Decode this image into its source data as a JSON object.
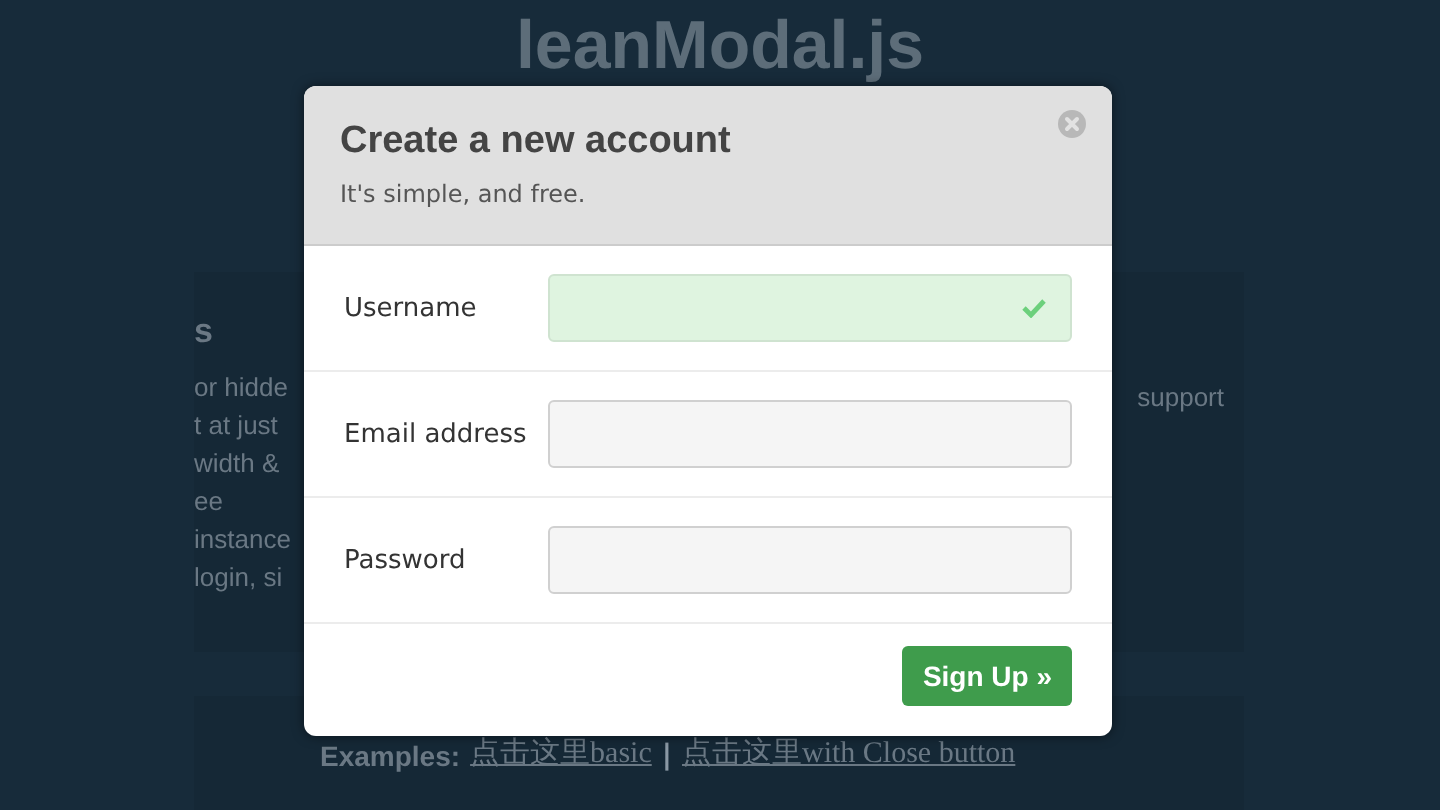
{
  "page": {
    "title": "leanModal.js",
    "panel": {
      "heading": "s",
      "left_lines": [
        "or hidde",
        "t at just",
        "width &",
        "ee",
        "instance",
        "login, si"
      ],
      "right_lines": [
        "support"
      ]
    },
    "examples": {
      "label": "Examples:",
      "separator": "|",
      "links": [
        "点击这里basic",
        "点击这里with Close button"
      ]
    }
  },
  "modal": {
    "title": "Create a new account",
    "subtitle": "It's simple, and free.",
    "fields": [
      {
        "label": "Username",
        "valid": true
      },
      {
        "label": "Email address",
        "valid": false
      },
      {
        "label": "Password",
        "valid": false
      }
    ],
    "submit": "Sign Up »"
  }
}
